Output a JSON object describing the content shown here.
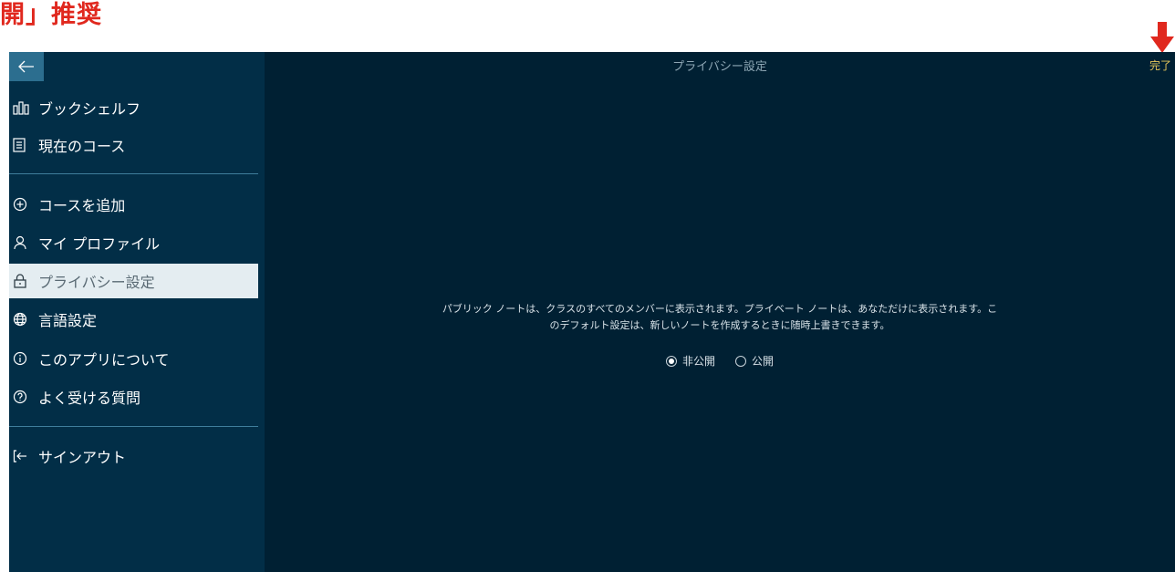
{
  "annotation": {
    "heading": "開」推奨"
  },
  "header": {
    "title": "プライバシー設定",
    "done_label": "完了"
  },
  "sidebar": {
    "items": [
      {
        "icon": "bookshelf-icon",
        "label": "ブックシェルフ"
      },
      {
        "icon": "document-icon",
        "label": "現在のコース"
      },
      {
        "icon": "add-circle-icon",
        "label": "コースを追加"
      },
      {
        "icon": "person-icon",
        "label": "マイ プロファイル"
      },
      {
        "icon": "lock-icon",
        "label": "プライバシー設定",
        "selected": true
      },
      {
        "icon": "globe-icon",
        "label": "言語設定"
      },
      {
        "icon": "info-icon",
        "label": "このアプリについて"
      },
      {
        "icon": "help-icon",
        "label": "よく受ける質問"
      },
      {
        "icon": "sign-out-icon",
        "label": "サインアウト"
      }
    ]
  },
  "main": {
    "description_line1": "パブリック ノートは、クラスのすべてのメンバーに表示されます。プライベート ノートは、あなただけに表示されます。こ",
    "description_line2": "のデフォルト設定は、新しいノートを作成するときに随時上書きできます。",
    "options": [
      {
        "label": "非公開",
        "checked": true
      },
      {
        "label": "公開",
        "checked": false
      }
    ]
  },
  "colors": {
    "sidebar_bg": "#022e47",
    "main_bg": "#002033",
    "selected_bg": "#e4edf1",
    "accent_done": "#e7c75a",
    "annotation_red": "#e0281e"
  }
}
